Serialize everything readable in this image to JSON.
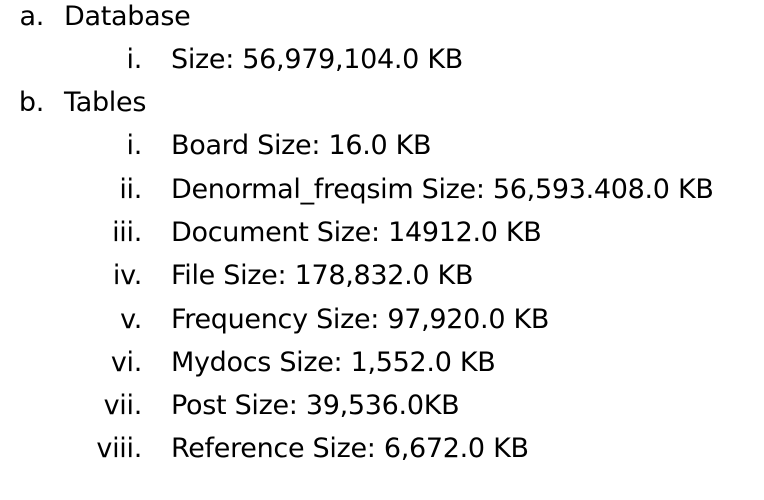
{
  "outline": {
    "database": {
      "marker": "a.",
      "label": "Database",
      "items": [
        {
          "marker": "i.",
          "text": "Size: 56,979,104.0 KB"
        }
      ]
    },
    "tables": {
      "marker": "b.",
      "label": "Tables",
      "items": [
        {
          "marker": "i.",
          "text": "Board Size: 16.0 KB"
        },
        {
          "marker": "ii.",
          "text": "Denormal_freqsim Size: 56,593.408.0 KB"
        },
        {
          "marker": "iii.",
          "text": "Document Size: 14912.0 KB"
        },
        {
          "marker": "iv.",
          "text": "File Size: 178,832.0 KB"
        },
        {
          "marker": "v.",
          "text": "Frequency Size: 97,920.0 KB"
        },
        {
          "marker": "vi.",
          "text": "Mydocs Size: 1,552.0 KB"
        },
        {
          "marker": "vii.",
          "text": "Post Size: 39,536.0KB"
        },
        {
          "marker": "viii.",
          "text": "Reference Size: 6,672.0 KB"
        }
      ]
    }
  }
}
